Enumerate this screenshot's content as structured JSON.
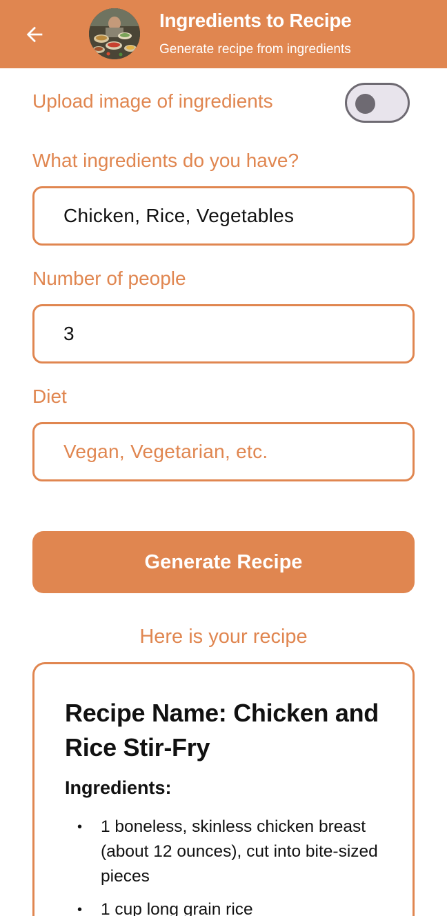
{
  "header": {
    "back_icon": "arrow-left-icon",
    "avatar_icon": "ingredients-photo",
    "title": "Ingredients to Recipe",
    "subtitle": "Generate recipe from ingredients",
    "background_color": "#e08650"
  },
  "form": {
    "upload_toggle": {
      "label": "Upload image of ingredients",
      "checked": false
    },
    "ingredients": {
      "label": "What ingredients do you have?",
      "value": "Chicken, Rice, Vegetables",
      "placeholder": ""
    },
    "people": {
      "label": "Number of people",
      "value": "3",
      "placeholder": ""
    },
    "diet": {
      "label": "Diet",
      "value": "",
      "placeholder": "Vegan, Vegetarian, etc."
    },
    "generate_label": "Generate Recipe"
  },
  "result": {
    "label": "Here is your recipe",
    "recipe_name": "Recipe Name: Chicken and Rice Stir-Fry",
    "ingredients_heading": "Ingredients:",
    "ingredients": [
      "1 boneless, skinless chicken breast (about 12 ounces), cut into bite-sized pieces",
      "1 cup long grain rice"
    ]
  },
  "accent_color": "#e08650"
}
